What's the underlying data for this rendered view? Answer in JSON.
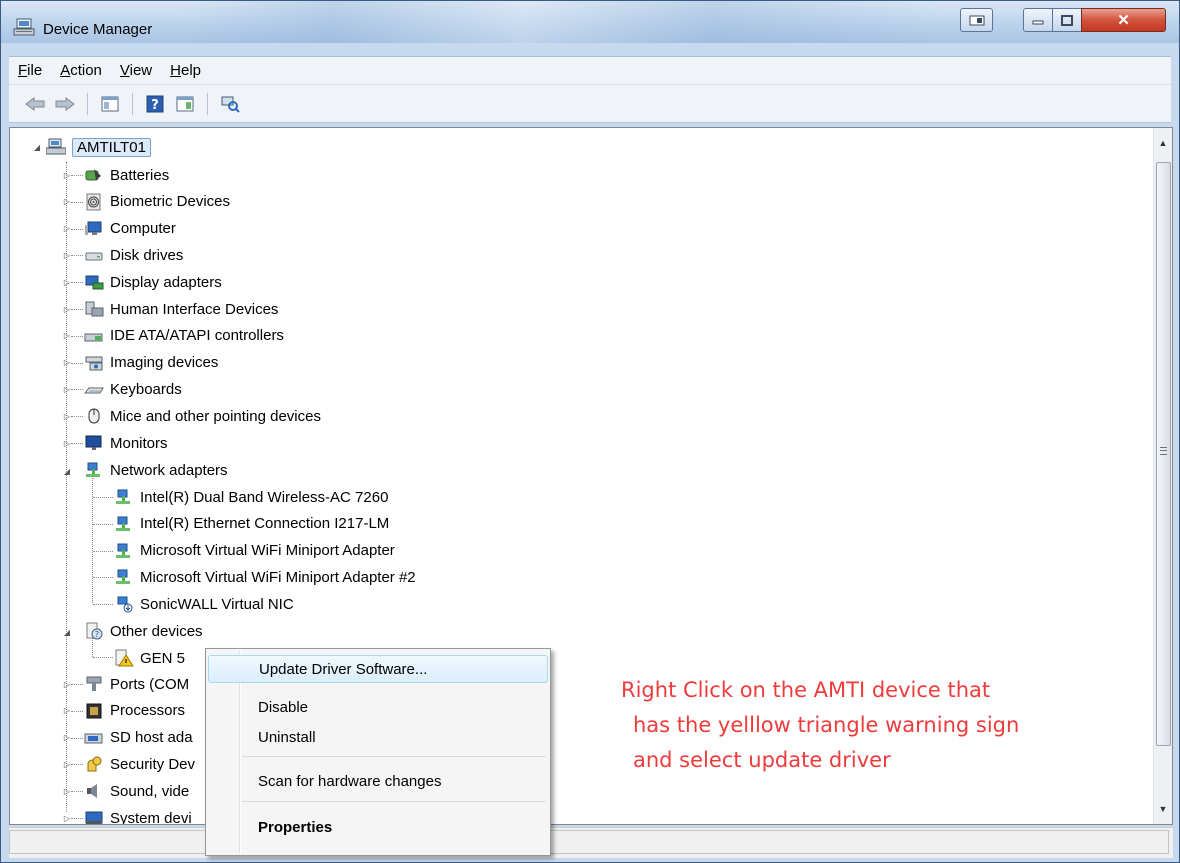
{
  "window": {
    "title": "Device Manager"
  },
  "menu": [
    {
      "label": "File",
      "key": "F",
      "rest": "ile"
    },
    {
      "label": "Action",
      "key": "A",
      "rest": "ction"
    },
    {
      "label": "View",
      "key": "V",
      "rest": "iew"
    },
    {
      "label": "Help",
      "key": "H",
      "rest": "elp"
    }
  ],
  "tree": {
    "root": "AMTILT01",
    "categories": [
      {
        "label": "Batteries",
        "icon": "battery-icon"
      },
      {
        "label": "Biometric Devices",
        "icon": "fingerprint-icon"
      },
      {
        "label": "Computer",
        "icon": "computer-icon"
      },
      {
        "label": "Disk drives",
        "icon": "disk-icon"
      },
      {
        "label": "Display adapters",
        "icon": "display-adapter-icon"
      },
      {
        "label": "Human Interface Devices",
        "icon": "hid-icon"
      },
      {
        "label": "IDE ATA/ATAPI controllers",
        "icon": "ide-icon"
      },
      {
        "label": "Imaging devices",
        "icon": "camera-icon"
      },
      {
        "label": "Keyboards",
        "icon": "keyboard-icon"
      },
      {
        "label": "Mice and other pointing devices",
        "icon": "mouse-icon"
      },
      {
        "label": "Monitors",
        "icon": "monitor-icon"
      }
    ],
    "network": {
      "label": "Network adapters",
      "children": [
        "Intel(R) Dual Band Wireless-AC 7260",
        "Intel(R) Ethernet Connection I217-LM",
        "Microsoft Virtual WiFi Miniport Adapter",
        "Microsoft Virtual WiFi Miniport Adapter #2",
        "SonicWALL Virtual NIC"
      ]
    },
    "other": {
      "label": "Other devices",
      "child": "GEN 5"
    },
    "after": [
      {
        "label": "Ports (COM",
        "icon": "port-icon"
      },
      {
        "label": "Processors",
        "icon": "processor-icon"
      },
      {
        "label": "SD host ada",
        "icon": "sd-icon"
      },
      {
        "label": "Security Dev",
        "icon": "security-icon"
      },
      {
        "label": "Sound, vide",
        "icon": "speaker-icon"
      },
      {
        "label": "System devi",
        "icon": "system-icon"
      }
    ]
  },
  "context_menu": {
    "update": "Update Driver Software...",
    "disable": "Disable",
    "uninstall": "Uninstall",
    "scan": "Scan for hardware changes",
    "properties": "Properties"
  },
  "annotation": {
    "line1": "Right Click on the AMTI  device that",
    "line2": "has the yelllow triangle warning sign",
    "line3": "and select update driver"
  },
  "colors": {
    "annotation": "#ee3b3b",
    "title_bar": "#bcd3ec",
    "close_button": "#c23a22"
  }
}
